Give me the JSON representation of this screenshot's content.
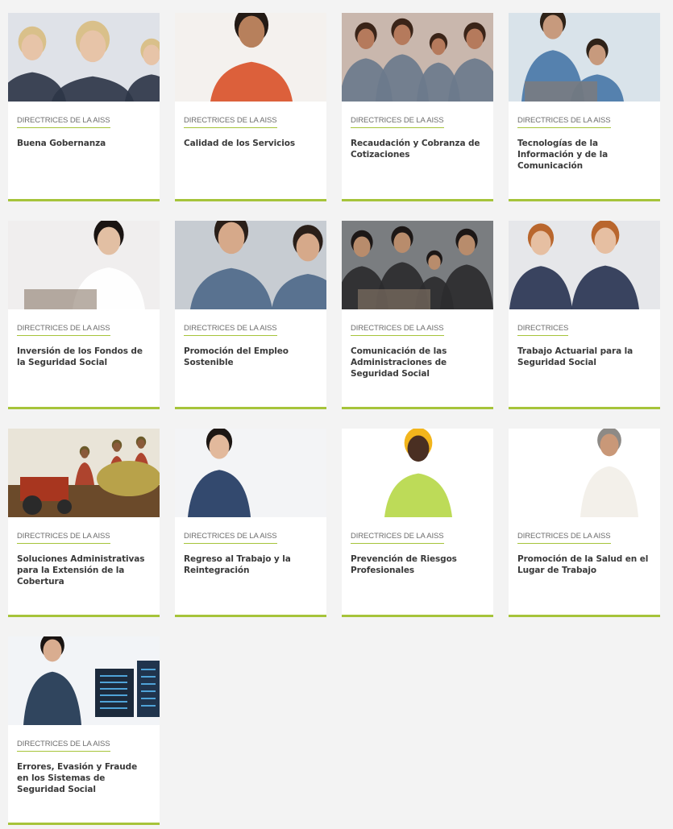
{
  "cards": [
    {
      "tag": "DIRECTRICES DE LA AISS",
      "title": "Buena Gobernanza",
      "image": "business-people-meeting-photo",
      "bg": "#dfe2e8",
      "fg": "#2e3648",
      "skin": "#e7c4a8",
      "hair": "#d9c08a"
    },
    {
      "tag": "DIRECTRICES DE LA AISS",
      "title": "Calidad de los Servicios",
      "image": "woman-with-phone-photo",
      "bg": "#f4f1ee",
      "fg": "#d9542b",
      "skin": "#b7805c",
      "hair": "#231a15"
    },
    {
      "tag": "DIRECTRICES DE LA AISS",
      "title": "Recaudación y Cobranza de Cotizaciones",
      "image": "family-at-table-photo",
      "bg": "#c9b7ad",
      "fg": "#6b7a8c",
      "skin": "#b57a5c",
      "hair": "#3a2418"
    },
    {
      "tag": "DIRECTRICES DE LA AISS",
      "title": "Tecnologías de la Información y de la Comunicación",
      "image": "office-computer-photo",
      "bg": "#d9e3ea",
      "fg": "#4a78a8",
      "skin": "#c79a7d",
      "hair": "#2e2218"
    },
    {
      "tag": "DIRECTRICES DE LA AISS",
      "title": "Inversión de los Fondos de la Seguridad Social",
      "image": "woman-laptop-photo",
      "bg": "#f0eeee",
      "fg": "#ffffff",
      "skin": "#e2bfa3",
      "hair": "#1a1412"
    },
    {
      "tag": "DIRECTRICES DE LA AISS",
      "title": "Promoción del Empleo Sostenible",
      "image": "job-interview-photo",
      "bg": "#c7ccd2",
      "fg": "#4f6a8a",
      "skin": "#d6a98a",
      "hair": "#2a1f19"
    },
    {
      "tag": "DIRECTRICES DE LA AISS",
      "title": "Comunicación de las Administraciones de Seguridad Social",
      "image": "family-laptop-photo",
      "bg": "#7a7d80",
      "fg": "#2b2b2e",
      "skin": "#b88c6c",
      "hair": "#1c1716"
    },
    {
      "tag": "DIRECTRICES",
      "title": "Trabajo Actuarial para la Seguridad Social",
      "image": "actuaries-tablet-photo",
      "bg": "#e6e7ea",
      "fg": "#2a3552",
      "skin": "#e6bfa2",
      "hair": "#b9662d"
    },
    {
      "tag": "DIRECTRICES DE LA AISS",
      "title": "Soluciones Administrativas para la Extensión de la Cobertura",
      "image": "farm-tractor-photo",
      "bg": "#e9e4d8",
      "fg": "#a8361f",
      "skin": "#8a5a3a",
      "hair": "#6b5a2a"
    },
    {
      "tag": "DIRECTRICES DE LA AISS",
      "title": "Regreso al Trabajo y la Reintegración",
      "image": "woman-tablet-photo",
      "bg": "#f3f4f6",
      "fg": "#233a62",
      "skin": "#e2b99c",
      "hair": "#1d1714"
    },
    {
      "tag": "DIRECTRICES DE LA AISS",
      "title": "Prevención de Riesgos Profesionales",
      "image": "construction-worker-photo",
      "bg": "#ffffff",
      "fg": "#b7d84a",
      "skin": "#4a2f22",
      "hair": "#f2b51c"
    },
    {
      "tag": "DIRECTRICES DE LA AISS",
      "title": "Promoción de la Salud en el Lugar de Trabajo",
      "image": "tai-chi-man-photo",
      "bg": "#ffffff",
      "fg": "#f2efe8",
      "skin": "#c99878",
      "hair": "#8d8a86"
    },
    {
      "tag": "DIRECTRICES DE LA AISS",
      "title": "Errores, Evasión y Fraude en los Sistemas de Seguridad Social",
      "image": "data-monitors-photo",
      "bg": "#f2f4f7",
      "fg": "#1f3550",
      "skin": "#d9ad90",
      "hair": "#1a1412"
    }
  ],
  "colors": {
    "accent": "#a6c43a",
    "page_background": "#f3f3f3",
    "card_background": "#ffffff",
    "title_text": "#3a3a3a",
    "tag_text": "#6d6d6d"
  }
}
